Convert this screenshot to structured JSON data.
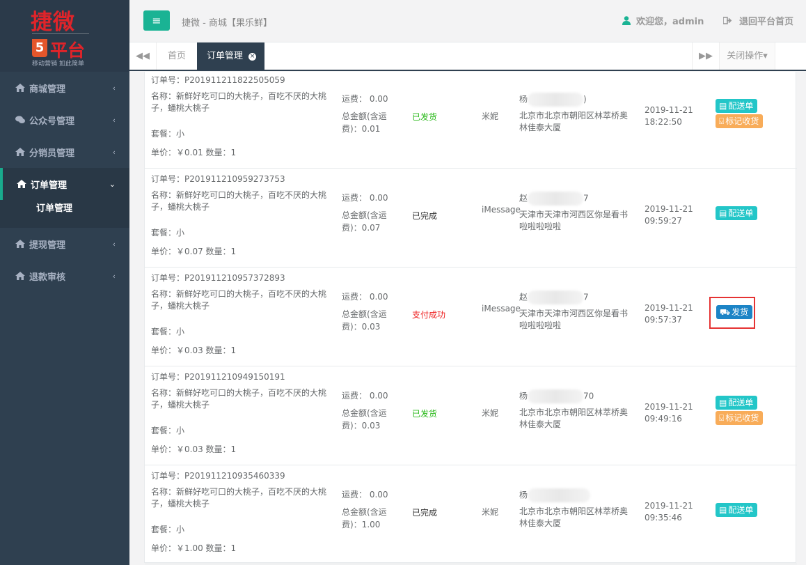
{
  "logo": {
    "title": "捷微",
    "five": "5",
    "sub": "平台",
    "slogan": "移动营销 如此简单"
  },
  "sidebar": {
    "items": [
      {
        "label": "商城管理",
        "chevron": "‹"
      },
      {
        "label": "公众号管理",
        "chevron": "‹"
      },
      {
        "label": "分销员管理",
        "chevron": "‹"
      },
      {
        "label": "订单管理",
        "chevron": "⌄"
      },
      {
        "label": "提现管理",
        "chevron": "‹"
      },
      {
        "label": "退款审核",
        "chevron": "‹"
      }
    ],
    "sub_label": "订单管理"
  },
  "header": {
    "menu_icon": "≡",
    "crumb": "捷微 - 商城【果乐鲜】",
    "welcome": "欢迎您，admin",
    "back": "退回平台首页"
  },
  "tabs": {
    "left_arrow": "◀◀",
    "home": "首页",
    "orders": "订单管理",
    "close": "×",
    "right_arrow": "▶▶",
    "ops": "关闭操作▾"
  },
  "orders": [
    {
      "id": "订单号：P201911211822505059",
      "name": "名称：新鲜好吃可口的大桃子，百吃不厌的大桃子，蟠桃大桃子",
      "pkg": "套餐：小",
      "price": "单价：￥0.01 数量：1",
      "ship": "运费： 0.00",
      "total": "总金额(含运费)：0.01",
      "status": "已发货",
      "status_color": "#2ab91a",
      "person": "米妮",
      "recv_prefix": "杨",
      "recv_suffix": ")",
      "addr": "北京市北京市朝阳区林萃桥奥林佳泰大厦",
      "time": "2019-11-21 18:22:50",
      "btn1": "配送单",
      "btn2": "标记收货"
    },
    {
      "id": "订单号：P201911210959273753",
      "name": "名称：新鲜好吃可口的大桃子，百吃不厌的大桃子，蟠桃大桃子",
      "pkg": "套餐：小",
      "price": "单价：￥0.07 数量：1",
      "ship": "运费： 0.00",
      "total": "总金额(含运费)：0.07",
      "status": "已完成",
      "status_color": "#333333",
      "person": "iMessage",
      "recv_prefix": "赵",
      "recv_suffix": "7",
      "addr": "天津市天津市河西区你是看书啦啦啦啦啦",
      "time": "2019-11-21 09:59:27",
      "btn1": "配送单"
    },
    {
      "id": "订单号：P201911210957372893",
      "name": "名称：新鲜好吃可口的大桃子，百吃不厌的大桃子，蟠桃大桃子",
      "pkg": "套餐：小",
      "price": "单价：￥0.03 数量：1",
      "ship": "运费： 0.00",
      "total": "总金额(含运费)：0.03",
      "status": "支付成功",
      "status_color": "#ee2222",
      "person": "iMessage",
      "recv_prefix": "赵",
      "recv_suffix": "7",
      "addr": "天津市天津市河西区你是看书啦啦啦啦啦",
      "time": "2019-11-21 09:57:37",
      "btn_ship": "发货"
    },
    {
      "id": "订单号：P201911210949150191",
      "name": "名称：新鲜好吃可口的大桃子，百吃不厌的大桃子，蟠桃大桃子",
      "pkg": "套餐：小",
      "price": "单价：￥0.03 数量：1",
      "ship": "运费： 0.00",
      "total": "总金额(含运费)：0.03",
      "status": "已发货",
      "status_color": "#2ab91a",
      "person": "米妮",
      "recv_prefix": "杨",
      "recv_suffix": "70",
      "addr": "北京市北京市朝阳区林萃桥奥林佳泰大厦",
      "time": "2019-11-21 09:49:16",
      "btn1": "配送单",
      "btn2": "标记收货"
    },
    {
      "id": "订单号：P201911210935460339",
      "name": "名称：新鲜好吃可口的大桃子，百吃不厌的大桃子，蟠桃大桃子",
      "pkg": "套餐：小",
      "price": "单价：￥1.00 数量：1",
      "ship": "运费： 0.00",
      "total": "总金额(含运费)：1.00",
      "status": "已完成",
      "status_color": "#333333",
      "person": "米妮",
      "recv_prefix": "杨",
      "recv_suffix": "",
      "addr": "北京市北京市朝阳区林萃桥奥林佳泰大厦",
      "time": "2019-11-21 09:35:46",
      "btn1": "配送单"
    }
  ],
  "colors": {
    "accent": "#1ab394",
    "sidebar_bg": "#2f4050",
    "teal_btn": "#23c6c8",
    "orange_btn": "#f8ac59",
    "blue_btn": "#1c84c6",
    "highlight": "#e53333"
  }
}
